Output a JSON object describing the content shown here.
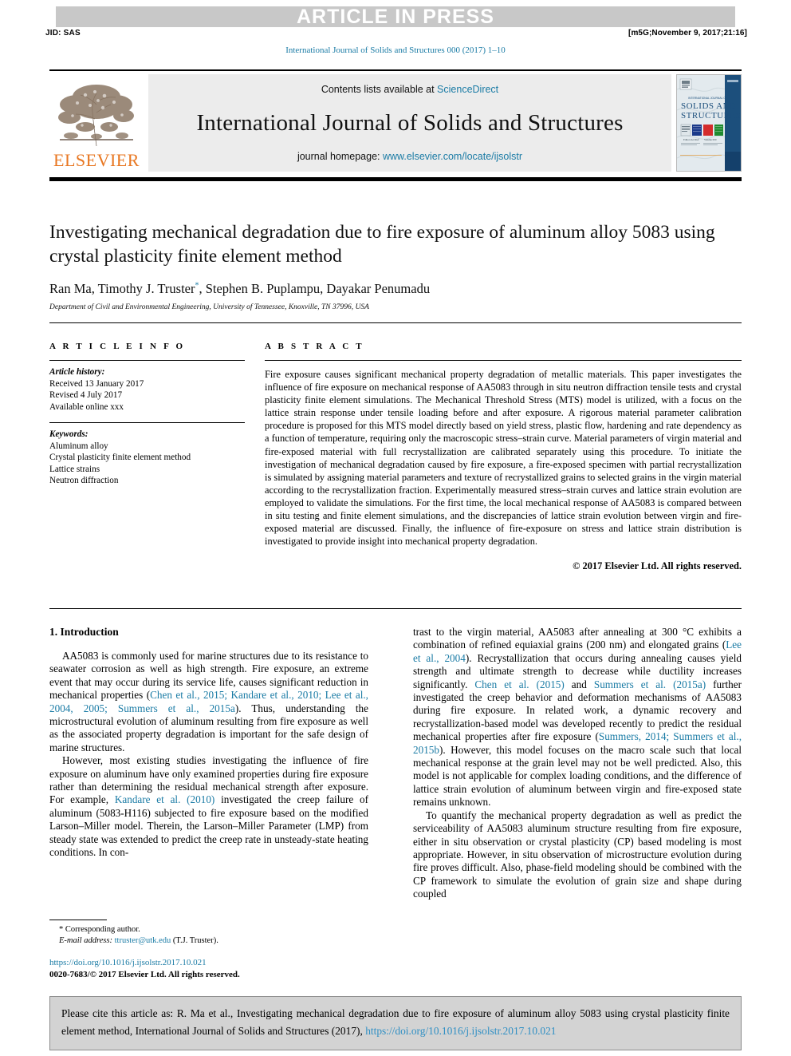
{
  "banner": {
    "press_label": "ARTICLE IN PRESS",
    "jid": "JID: SAS",
    "stamp": "[m5G;November 9, 2017;21:16]",
    "journal_ref": "International Journal of Solids and Structures 000 (2017) 1–10"
  },
  "masthead": {
    "contents_prefix": "Contents lists available at ",
    "contents_link": "ScienceDirect",
    "journal_title": "International Journal of Solids and Structures",
    "homepage_prefix": "journal homepage: ",
    "homepage_url": "www.elsevier.com/locate/ijsolstr",
    "publisher_wordmark": "ELSEVIER",
    "publisher_logo_icon": "elsevier-tree-icon",
    "cover_icon": "journal-cover-thumbnail",
    "cover_title_line1": "SOLIDS AND",
    "cover_title_line2": "STRUCTURES",
    "accent_color": "#1a7ba5",
    "brand_color": "#e87722"
  },
  "article": {
    "title": "Investigating mechanical degradation due to fire exposure of aluminum alloy 5083 using crystal plasticity finite element method",
    "authors_pre": "Ran Ma, Timothy J. Truster",
    "corresponding_marker": "*",
    "authors_post": ", Stephen B. Puplampu, Dayakar Penumadu",
    "affiliation": "Department of Civil and Environmental Engineering, University of Tennessee, Knoxville, TN 37996, USA"
  },
  "article_info": {
    "heading": "A R T I C L E   I N F O",
    "history_label": "Article history:",
    "history": [
      "Received 13 January 2017",
      "Revised 4 July 2017",
      "Available online xxx"
    ],
    "keywords_label": "Keywords:",
    "keywords": [
      "Aluminum alloy",
      "Crystal plasticity finite element method",
      "Lattice strains",
      "Neutron diffraction"
    ]
  },
  "abstract": {
    "heading": "A B S T R A C T",
    "text": "Fire exposure causes significant mechanical property degradation of metallic materials. This paper investigates the influence of fire exposure on mechanical response of AA5083 through in situ neutron diffraction tensile tests and crystal plasticity finite element simulations. The Mechanical Threshold Stress (MTS) model is utilized, with a focus on the lattice strain response under tensile loading before and after exposure. A rigorous material parameter calibration procedure is proposed for this MTS model directly based on yield stress, plastic flow, hardening and rate dependency as a function of temperature, requiring only the macroscopic stress–strain curve. Material parameters of virgin material and fire-exposed material with full recrystallization are calibrated separately using this procedure. To initiate the investigation of mechanical degradation caused by fire exposure, a fire-exposed specimen with partial recrystallization is simulated by assigning material parameters and texture of recrystallized grains to selected grains in the virgin material according to the recrystallization fraction. Experimentally measured stress–strain curves and lattice strain evolution are employed to validate the simulations. For the first time, the local mechanical response of AA5083 is compared between in situ testing and finite element simulations, and the discrepancies of lattice strain evolution between virgin and fire-exposed material are discussed. Finally, the influence of fire-exposure on stress and lattice strain distribution is investigated to provide insight into mechanical property degradation.",
    "copyright": "© 2017 Elsevier Ltd. All rights reserved."
  },
  "body": {
    "section_heading": "1. Introduction",
    "left_paragraphs": [
      "AA5083 is commonly used for marine structures due to its resistance to seawater corrosion as well as high strength. Fire exposure, an extreme event that may occur during its service life, causes significant reduction in mechanical properties (Chen et al., 2015; Kandare et al., 2010; Lee et al., 2004, 2005; Summers et al., 2015a). Thus, understanding the microstructural evolution of aluminum resulting from fire exposure as well as the associated property degradation is important for the safe design of marine structures.",
      "However, most existing studies investigating the influence of fire exposure on aluminum have only examined properties during fire exposure rather than determining the residual mechanical strength after exposure. For example, Kandare et al. (2010) investigated the creep failure of aluminum (5083-H116) subjected to fire exposure based on the modified Larson–Miller model. Therein, the Larson–Miller Parameter (LMP) from steady state was extended to predict the creep rate in unsteady-state heating conditions. In con-"
    ],
    "right_paragraphs": [
      "trast to the virgin material, AA5083 after annealing at 300 °C exhibits a combination of refined equiaxial grains (200 nm) and elongated grains (Lee et al., 2004). Recrystallization that occurs during annealing causes yield strength and ultimate strength to decrease while ductility increases significantly. Chen et al. (2015) and Summers et al. (2015a) further investigated the creep behavior and deformation mechanisms of AA5083 during fire exposure. In related work, a dynamic recovery and recrystallization-based model was developed recently to predict the residual mechanical properties after fire exposure (Summers, 2014; Summers et al., 2015b). However, this model focuses on the macro scale such that local mechanical response at the grain level may not be well predicted. Also, this model is not applicable for complex loading conditions, and the difference of lattice strain evolution of aluminum between virgin and fire-exposed state remains unknown.",
      "To quantify the mechanical property degradation as well as predict the serviceability of AA5083 aluminum structure resulting from fire exposure, either in situ observation or crystal plasticity (CP) based modeling is most appropriate. However, in situ observation of microstructure evolution during fire proves difficult. Also, phase-field modeling should be combined with the CP framework to simulate the evolution of grain size and shape during coupled"
    ]
  },
  "footnotes": {
    "corresponding": "* Corresponding author.",
    "email_label": "E-mail address:",
    "email": "ttruster@utk.edu",
    "email_suffix": "(T.J. Truster).",
    "doi_url": "https://doi.org/10.1016/j.ijsolstr.2017.10.021",
    "issn_line": "0020-7683/© 2017 Elsevier Ltd. All rights reserved."
  },
  "cite_box": {
    "text_before": "Please cite this article as: R. Ma et al., Investigating mechanical degradation due to fire exposure of aluminum alloy 5083 using crystal plasticity finite element method, International Journal of Solids and Structures (2017), ",
    "doi": "https://doi.org/10.1016/j.ijsolstr.2017.10.021"
  }
}
